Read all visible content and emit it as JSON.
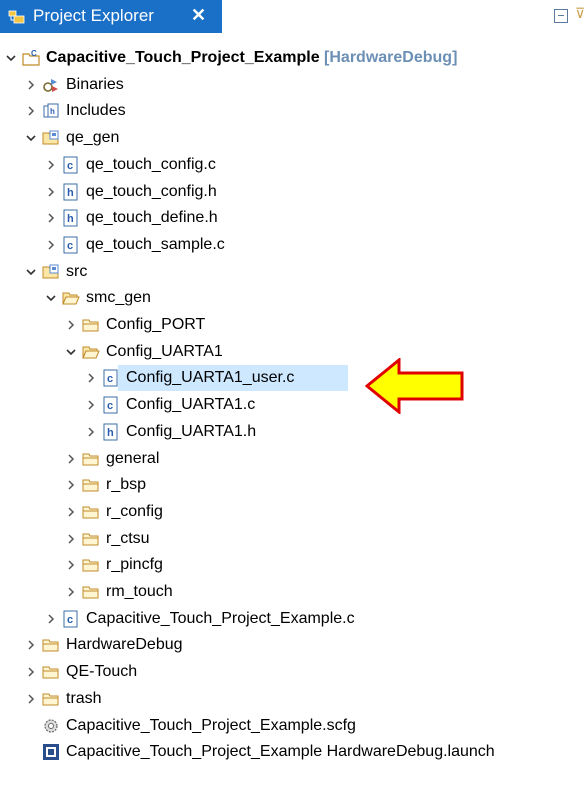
{
  "panel": {
    "title": "Project Explorer",
    "close_glyph": "✕"
  },
  "tree": [
    {
      "label": "Capacitive_Touch_Project_Example",
      "decoration": "[HardwareDebug]",
      "icon": "c-project-icon",
      "expanded": true,
      "depth": 0
    },
    {
      "label": "Binaries",
      "icon": "binaries-icon",
      "expanded": false,
      "depth": 1
    },
    {
      "label": "Includes",
      "icon": "includes-icon",
      "expanded": false,
      "depth": 1
    },
    {
      "label": "qe_gen",
      "icon": "source-folder-icon",
      "expanded": true,
      "depth": 1
    },
    {
      "label": "qe_touch_config.c",
      "icon": "c-file-icon",
      "expanded": false,
      "depth": 2
    },
    {
      "label": "qe_touch_config.h",
      "icon": "h-file-icon",
      "expanded": false,
      "depth": 2
    },
    {
      "label": "qe_touch_define.h",
      "icon": "h-file-icon",
      "expanded": false,
      "depth": 2
    },
    {
      "label": "qe_touch_sample.c",
      "icon": "c-file-icon",
      "expanded": false,
      "depth": 2
    },
    {
      "label": "src",
      "icon": "source-folder-icon",
      "expanded": true,
      "depth": 1
    },
    {
      "label": "smc_gen",
      "icon": "folder-open-icon",
      "expanded": true,
      "depth": 2
    },
    {
      "label": "Config_PORT",
      "icon": "folder-icon",
      "expanded": false,
      "depth": 3
    },
    {
      "label": "Config_UARTA1",
      "icon": "folder-open-icon",
      "expanded": true,
      "depth": 3
    },
    {
      "label": "Config_UARTA1_user.c",
      "icon": "c-file-icon",
      "expanded": false,
      "depth": 4,
      "selected": true
    },
    {
      "label": "Config_UARTA1.c",
      "icon": "c-file-icon",
      "expanded": false,
      "depth": 4
    },
    {
      "label": "Config_UARTA1.h",
      "icon": "h-file-icon",
      "expanded": false,
      "depth": 4
    },
    {
      "label": "general",
      "icon": "folder-icon",
      "expanded": false,
      "depth": 3
    },
    {
      "label": "r_bsp",
      "icon": "folder-icon",
      "expanded": false,
      "depth": 3
    },
    {
      "label": "r_config",
      "icon": "folder-icon",
      "expanded": false,
      "depth": 3
    },
    {
      "label": "r_ctsu",
      "icon": "folder-icon",
      "expanded": false,
      "depth": 3
    },
    {
      "label": "r_pincfg",
      "icon": "folder-icon",
      "expanded": false,
      "depth": 3
    },
    {
      "label": "rm_touch",
      "icon": "folder-icon",
      "expanded": false,
      "depth": 3
    },
    {
      "label": "Capacitive_Touch_Project_Example.c",
      "icon": "c-file-icon",
      "expanded": false,
      "depth": 2
    },
    {
      "label": "HardwareDebug",
      "icon": "folder-icon",
      "expanded": false,
      "depth": 1
    },
    {
      "label": "QE-Touch",
      "icon": "folder-icon",
      "expanded": false,
      "depth": 1
    },
    {
      "label": "trash",
      "icon": "folder-icon",
      "expanded": false,
      "depth": 1
    },
    {
      "label": "Capacitive_Touch_Project_Example.scfg",
      "icon": "gear-file-icon",
      "expanded": null,
      "depth": 1
    },
    {
      "label": "Capacitive_Touch_Project_Example HardwareDebug.launch",
      "icon": "launch-config-icon",
      "expanded": null,
      "depth": 1
    }
  ],
  "colors": {
    "tab_bg": "#1a6fc7",
    "selection_bg": "#cde8ff",
    "decoration_text": "#6c8fb5",
    "callout_fill": "#ffff00",
    "callout_stroke": "#e00000"
  },
  "annotation": {
    "icon": "arrow-left-callout-icon"
  }
}
